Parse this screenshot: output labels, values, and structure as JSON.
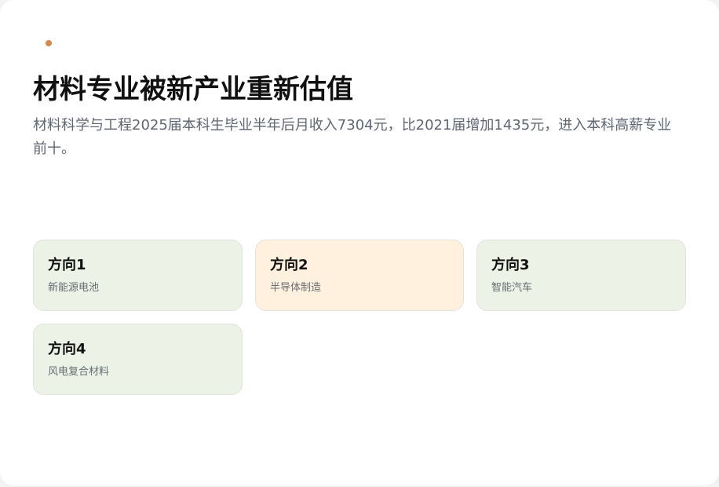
{
  "header": {
    "title": "材料专业被新产业重新估值",
    "subtitle": "材料科学与工程2025届本科生毕业半年后月收入7304元，比2021届增加1435元，进入本科高薪专业前十。"
  },
  "colors": {
    "accent_dot": "#d9874d",
    "green_card": "#edf2e6",
    "orange_card": "#fff1dd"
  },
  "cards": [
    {
      "title": "方向1",
      "description": "新能源电池",
      "background": "#edf2e6"
    },
    {
      "title": "方向2",
      "description": "半导体制造",
      "background": "#fff1dd"
    },
    {
      "title": "方向3",
      "description": "智能汽车",
      "background": "#edf2e6"
    },
    {
      "title": "方向4",
      "description": "风电复合材料",
      "background": "#edf2e6"
    }
  ]
}
